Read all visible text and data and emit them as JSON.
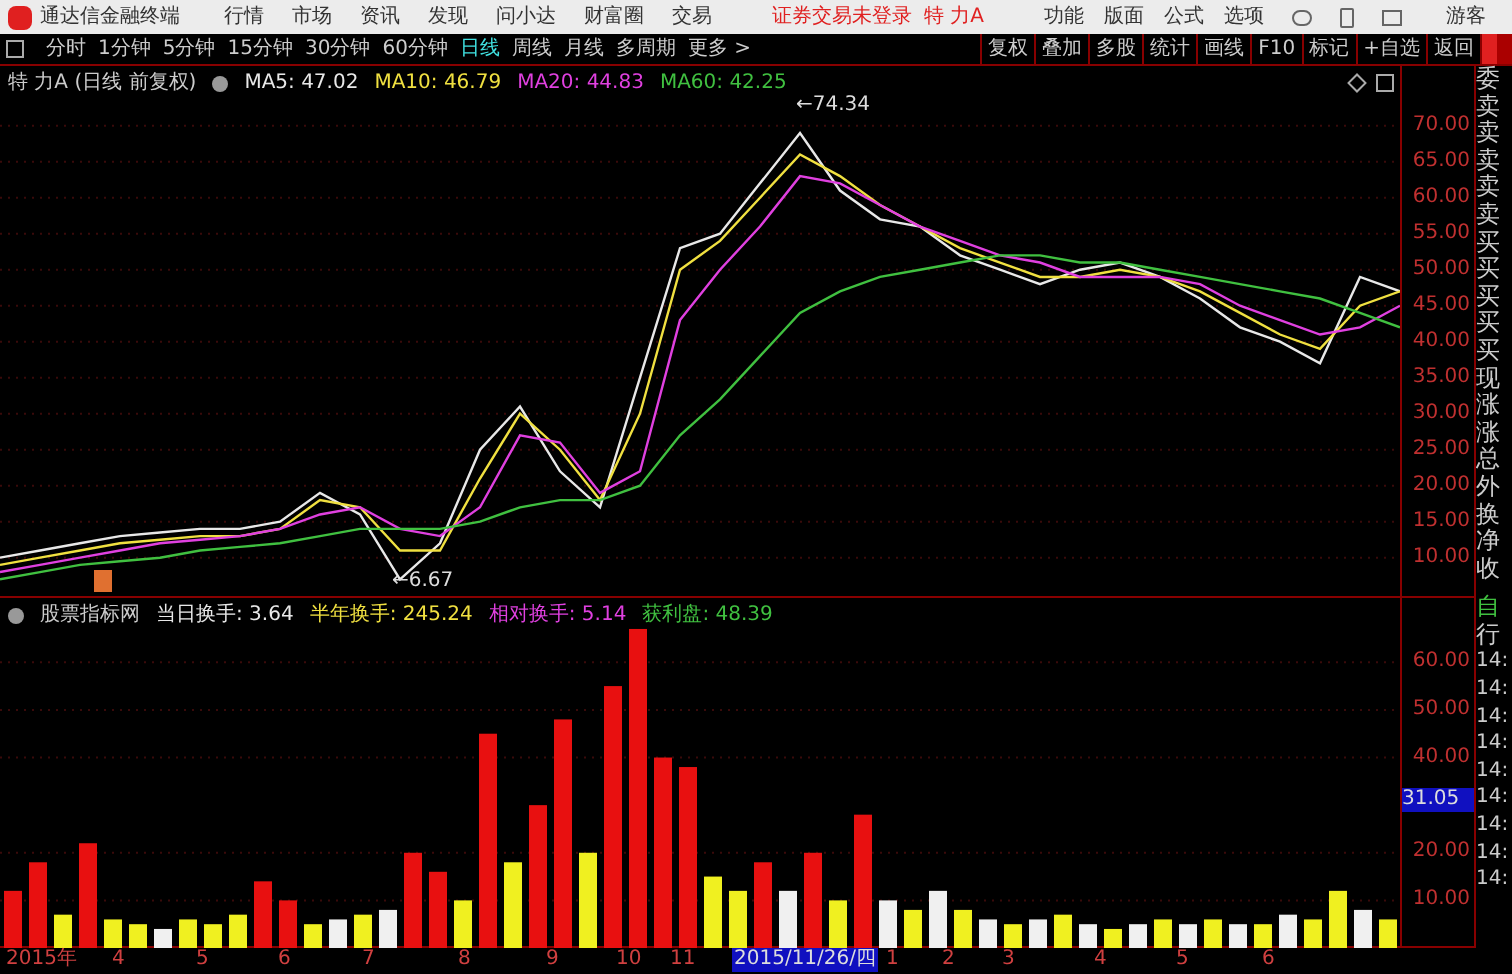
{
  "title_bar": {
    "app_name": "通达信金融终端",
    "menus": [
      "行情",
      "市场",
      "资讯",
      "发现",
      "问小达",
      "财富圈",
      "交易"
    ],
    "login_status": "证券交易未登录",
    "stock": "特 力A",
    "right_menus": [
      "功能",
      "版面",
      "公式",
      "选项"
    ],
    "user": "游客"
  },
  "period_tabs": [
    {
      "label": "分时",
      "selected": false
    },
    {
      "label": "1分钟",
      "selected": false
    },
    {
      "label": "5分钟",
      "selected": false
    },
    {
      "label": "15分钟",
      "selected": false
    },
    {
      "label": "30分钟",
      "selected": false
    },
    {
      "label": "60分钟",
      "selected": false
    },
    {
      "label": "日线",
      "selected": true
    },
    {
      "label": "周线",
      "selected": false
    },
    {
      "label": "月线",
      "selected": false
    },
    {
      "label": "多周期",
      "selected": false
    },
    {
      "label": "更多 >",
      "selected": false
    }
  ],
  "tool_buttons": [
    "复权",
    "叠加",
    "多股",
    "统计",
    "画线",
    "F10",
    "标记",
    "+自选",
    "返回"
  ],
  "price_chart": {
    "title": "特 力A (日线 前复权)",
    "legend": [
      {
        "label": "MA5: 47.02",
        "color": "#e8e8e8"
      },
      {
        "label": "MA10: 46.79",
        "color": "#f0e040"
      },
      {
        "label": "MA20: 44.83",
        "color": "#e040e0"
      },
      {
        "label": "MA60: 42.25",
        "color": "#40c040"
      }
    ],
    "high_label": "←74.34",
    "low_label": "←6.67",
    "chart_data": {
      "type": "line",
      "grid": true,
      "ylim": [
        4.4,
        78.3
      ],
      "yticks": [
        {
          "value": 10,
          "label": "10.00"
        },
        {
          "value": 15,
          "label": "15.00"
        },
        {
          "value": 20,
          "label": "20.00"
        },
        {
          "value": 25,
          "label": "25.00"
        },
        {
          "value": 30,
          "label": "30.00"
        },
        {
          "value": 35,
          "label": "35.00"
        },
        {
          "value": 40,
          "label": "40.00"
        },
        {
          "value": 45,
          "label": "45.00"
        },
        {
          "value": 50,
          "label": "50.00"
        },
        {
          "value": 55,
          "label": "55.00"
        },
        {
          "value": 60,
          "label": "60.00"
        },
        {
          "value": 65,
          "label": "65.00"
        },
        {
          "value": 70,
          "label": "70.00"
        }
      ],
      "series": [
        {
          "color": "#e8e8e8",
          "values": [
            10,
            11,
            12,
            13,
            13.5,
            14,
            14,
            15,
            19,
            16,
            7,
            12,
            25,
            31,
            22,
            17,
            35,
            53,
            55,
            62,
            69,
            61,
            57,
            56,
            52,
            50,
            48,
            50,
            51,
            49,
            46,
            42,
            40,
            37,
            49,
            47
          ]
        },
        {
          "color": "#f0e040",
          "values": [
            9,
            10,
            11,
            12,
            12.5,
            13,
            13,
            14,
            18,
            17,
            11,
            11,
            21,
            30,
            25,
            18,
            30,
            50,
            54,
            60,
            66,
            63,
            59,
            56,
            53,
            51,
            49,
            49,
            50,
            49,
            47,
            44,
            41,
            39,
            45,
            47
          ]
        },
        {
          "color": "#e040e0",
          "values": [
            8,
            9,
            10,
            11,
            12,
            12.5,
            13,
            14,
            16,
            17,
            14,
            13,
            17,
            27,
            26,
            19,
            22,
            43,
            50,
            56,
            63,
            62,
            59,
            56,
            54,
            52,
            51,
            49,
            49,
            49,
            48,
            45,
            43,
            41,
            42,
            45
          ]
        },
        {
          "color": "#40c040",
          "values": [
            7,
            8,
            9,
            9.5,
            10,
            11,
            11.5,
            12,
            13,
            14,
            14,
            14,
            15,
            17,
            18,
            18,
            20,
            27,
            32,
            38,
            44,
            47,
            49,
            50,
            51,
            52,
            52,
            51,
            51,
            50,
            49,
            48,
            47,
            46,
            44,
            42
          ]
        }
      ]
    }
  },
  "indicator_panel": {
    "name": "股票指标网",
    "legend": [
      {
        "label": "当日换手: 3.64",
        "color": "#e8e8e8"
      },
      {
        "label": "半年换手: 245.24",
        "color": "#f0e040"
      },
      {
        "label": "相对换手: 5.14",
        "color": "#e040e0"
      },
      {
        "label": "获利盘: 48.39",
        "color": "#40c040"
      }
    ],
    "cursor_value": "31.05",
    "chart_data": {
      "type": "bar",
      "grid": true,
      "stacked": true,
      "ylim": [
        0,
        73.5
      ],
      "yticks": [
        {
          "value": 10,
          "label": "10.00"
        },
        {
          "value": 20,
          "label": "20.00"
        },
        {
          "value": 40,
          "label": "40.00"
        },
        {
          "value": 50,
          "label": "50.00"
        },
        {
          "value": 60,
          "label": "60.00"
        }
      ],
      "series": [
        {
          "color": "#e81010",
          "values": [
            12,
            18,
            null,
            22,
            null,
            null,
            null,
            null,
            null,
            null,
            14,
            10,
            null,
            null,
            null,
            null,
            20,
            16,
            null,
            45,
            null,
            30,
            48,
            null,
            55,
            67,
            40,
            38,
            null,
            null,
            18,
            null,
            20,
            null,
            28,
            null,
            null,
            null,
            null,
            null,
            null,
            null,
            null,
            null,
            null,
            null,
            null,
            null,
            null,
            null,
            null,
            null,
            null,
            null,
            null,
            null
          ]
        },
        {
          "color": "#f0f020",
          "values": [
            null,
            null,
            7,
            null,
            6,
            5,
            null,
            6,
            5,
            7,
            null,
            null,
            5,
            null,
            7,
            null,
            null,
            null,
            10,
            null,
            18,
            null,
            null,
            20,
            null,
            null,
            null,
            null,
            15,
            12,
            null,
            null,
            null,
            10,
            null,
            null,
            8,
            null,
            8,
            null,
            5,
            null,
            7,
            null,
            4,
            null,
            6,
            null,
            6,
            null,
            5,
            null,
            6,
            12,
            null,
            6
          ]
        },
        {
          "color": "#f0f0f0",
          "values": [
            null,
            null,
            null,
            null,
            null,
            null,
            4,
            null,
            null,
            null,
            null,
            null,
            null,
            6,
            null,
            8,
            null,
            null,
            null,
            null,
            null,
            null,
            null,
            null,
            null,
            null,
            null,
            null,
            null,
            null,
            null,
            12,
            null,
            null,
            null,
            10,
            null,
            12,
            null,
            6,
            null,
            6,
            null,
            5,
            null,
            5,
            null,
            5,
            null,
            5,
            null,
            7,
            null,
            null,
            8,
            null
          ]
        }
      ]
    }
  },
  "x_axis": [
    {
      "label": "2015年",
      "selected": false
    },
    {
      "label": "4",
      "selected": false
    },
    {
      "label": "5",
      "selected": false
    },
    {
      "label": "6",
      "selected": false
    },
    {
      "label": "7",
      "selected": false
    },
    {
      "label": "8",
      "selected": false
    },
    {
      "label": "9",
      "selected": false
    },
    {
      "label": "10",
      "selected": false
    },
    {
      "label": "11",
      "selected": false
    },
    {
      "label": "2015/11/26/四",
      "selected": true
    },
    {
      "label": "1",
      "selected": false
    },
    {
      "label": "2",
      "selected": false
    },
    {
      "label": "3",
      "selected": false
    },
    {
      "label": "4",
      "selected": false
    },
    {
      "label": "5",
      "selected": false
    },
    {
      "label": "6",
      "selected": false
    }
  ],
  "quote_panel": {
    "labels": [
      "委",
      "卖",
      "卖",
      "卖",
      "卖",
      "卖",
      "买",
      "买",
      "买",
      "买",
      "买",
      "现",
      "涨",
      "涨",
      "总",
      "外",
      "换",
      "净",
      "收"
    ],
    "tab": "自",
    "tab2": "行",
    "times": [
      "14:",
      "14:",
      "14:",
      "14:",
      "14:",
      "14:",
      "14:",
      "14:",
      "14:"
    ]
  }
}
